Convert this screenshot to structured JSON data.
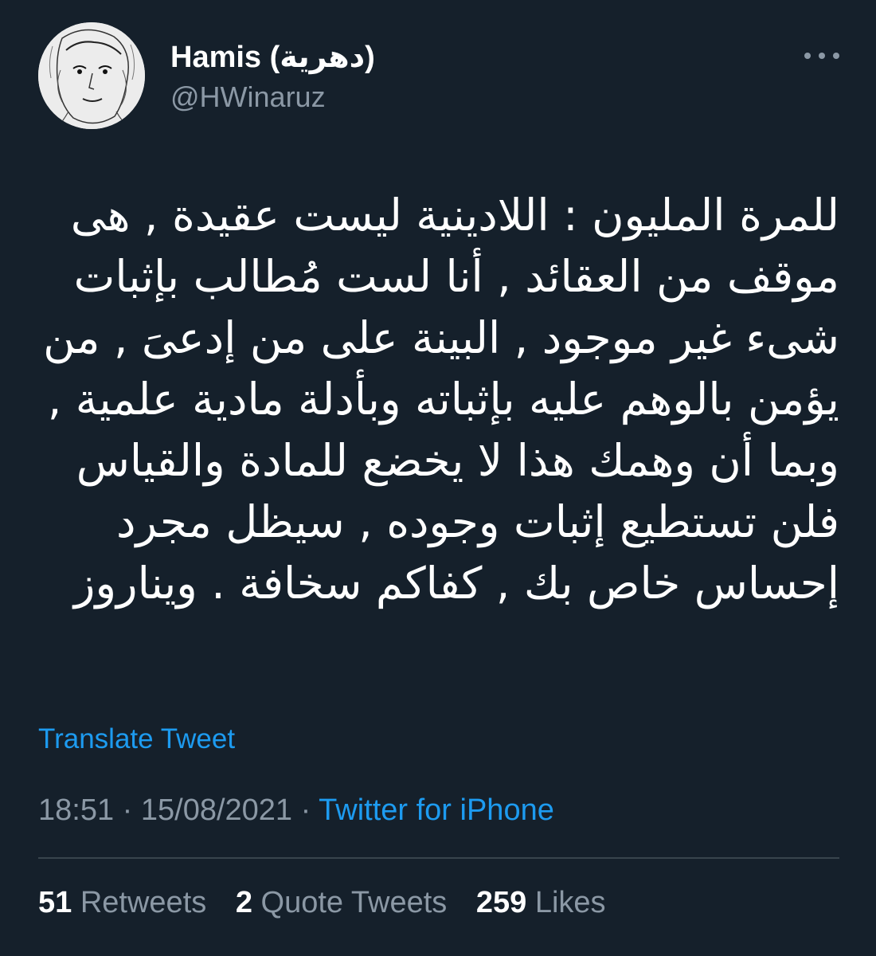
{
  "author": {
    "display_name": "Hamis (دهرية)",
    "handle": "@HWinaruz"
  },
  "tweet": {
    "lines": [
      "للمرة المليون : اللادينية ليست عقيدة , هى",
      "موقف من العقائد , أنا لست مُطالب بإثبات",
      "شىء غير موجود , البينة على من إدعىَ , من",
      "يؤمن بالوهم عليه بإثباته وبأدلة مادية علمية ,",
      "وبما أن وهمك هذا لا يخضع للمادة والقياس",
      "فلن تستطيع إثبات وجوده , سيظل مجرد",
      "إحساس خاص بك , كفاكم سخافة . ويناروز"
    ],
    "translate_label": "Translate Tweet",
    "time": "18:51",
    "separator": "·",
    "date": "15/08/2021",
    "source": "Twitter for iPhone"
  },
  "stats": {
    "retweets_count": "51",
    "retweets_label": "Retweets",
    "quotes_count": "2",
    "quotes_label": "Quote Tweets",
    "likes_count": "259",
    "likes_label": "Likes"
  },
  "icons": {
    "more": "more-dots-icon"
  },
  "colors": {
    "background": "#15202b",
    "text": "#ffffff",
    "secondary": "#8b98a5",
    "accent": "#1d9bf0",
    "divider": "#38444d"
  }
}
